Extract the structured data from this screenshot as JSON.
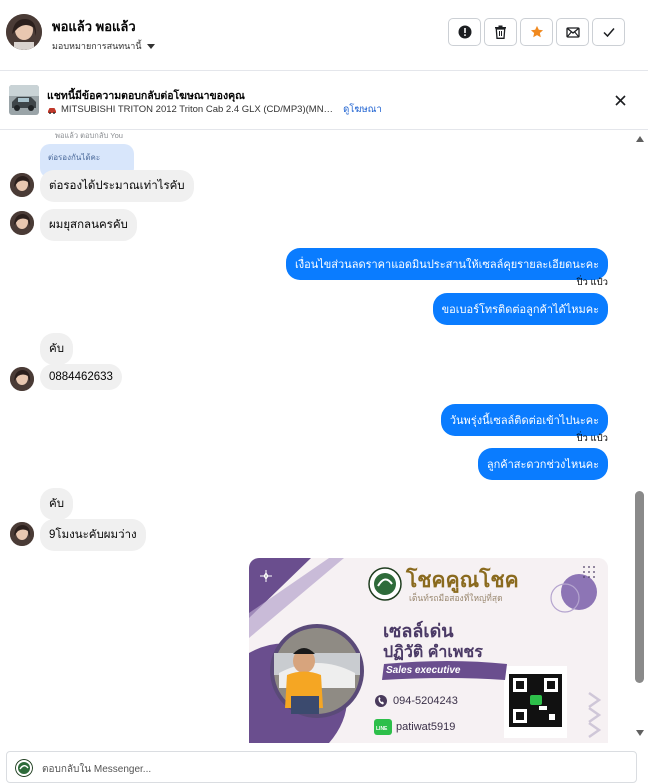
{
  "header": {
    "contact_name": "พอแล้ว พอแล้ว",
    "subtitle": "มอบหมายการสนทนานี้",
    "buttons": [
      "mark-spam",
      "delete",
      "star",
      "mark-unread",
      "done"
    ]
  },
  "ad_banner": {
    "title": "แชทนี้มีข้อความตอบกลับต่อโฆษณาของคุณ",
    "ad_text": "MITSUBISHI TRITON 2012 Triton Cab 2.4 GLX (CD/MP3)(MN…",
    "view_ad_link": "ดูโฆษณา"
  },
  "messages": {
    "reply_label": "พอแล้ว ตอบกลับ You",
    "quoted_text": "ต่อรองกันได้คะ",
    "m1": "ต่อรองได้ประมาณเท่าไรคับ",
    "m2": "ผมยุสกลนครคับ",
    "m3": "เงื่อนไขส่วนลดราคาแอดมินประสานให้เซลล์คุยรายละเอียดนะคะ",
    "sender1": "ปิ่ว แป๋ว",
    "m4": "ขอเบอร์โทรติดต่อลูกค้าได้ไหมคะ",
    "m5": "คับ",
    "m6": "0884462633",
    "m7": "วันพรุ่งนี้เซลล์ติดต่อเข้าไปนะคะ",
    "sender2": "ปิ่ว แป๋ว",
    "m8": "ลูกค้าสะดวกช่วงไหนคะ",
    "m9": "คับ",
    "m10": "9โมงนะคับผมว่าง"
  },
  "card": {
    "brand": "โชคคูณโชค",
    "tagline": "เต็นท์รถมือสองที่ใหญ่ที่สุด",
    "name": "เซลล์เด่น",
    "fullname": "ปฏิวัติ  คำเพชร",
    "role": "Sales executive",
    "phone": "094-5204243",
    "line_id": "patiwat5919"
  },
  "composer": {
    "placeholder": "ตอบกลับใน Messenger..."
  },
  "colors": {
    "outgoing_bubble": "#0a7cff",
    "incoming_bubble": "#f0f0f0",
    "star": "#f0891f",
    "card_purple": "#6a4e8e"
  }
}
